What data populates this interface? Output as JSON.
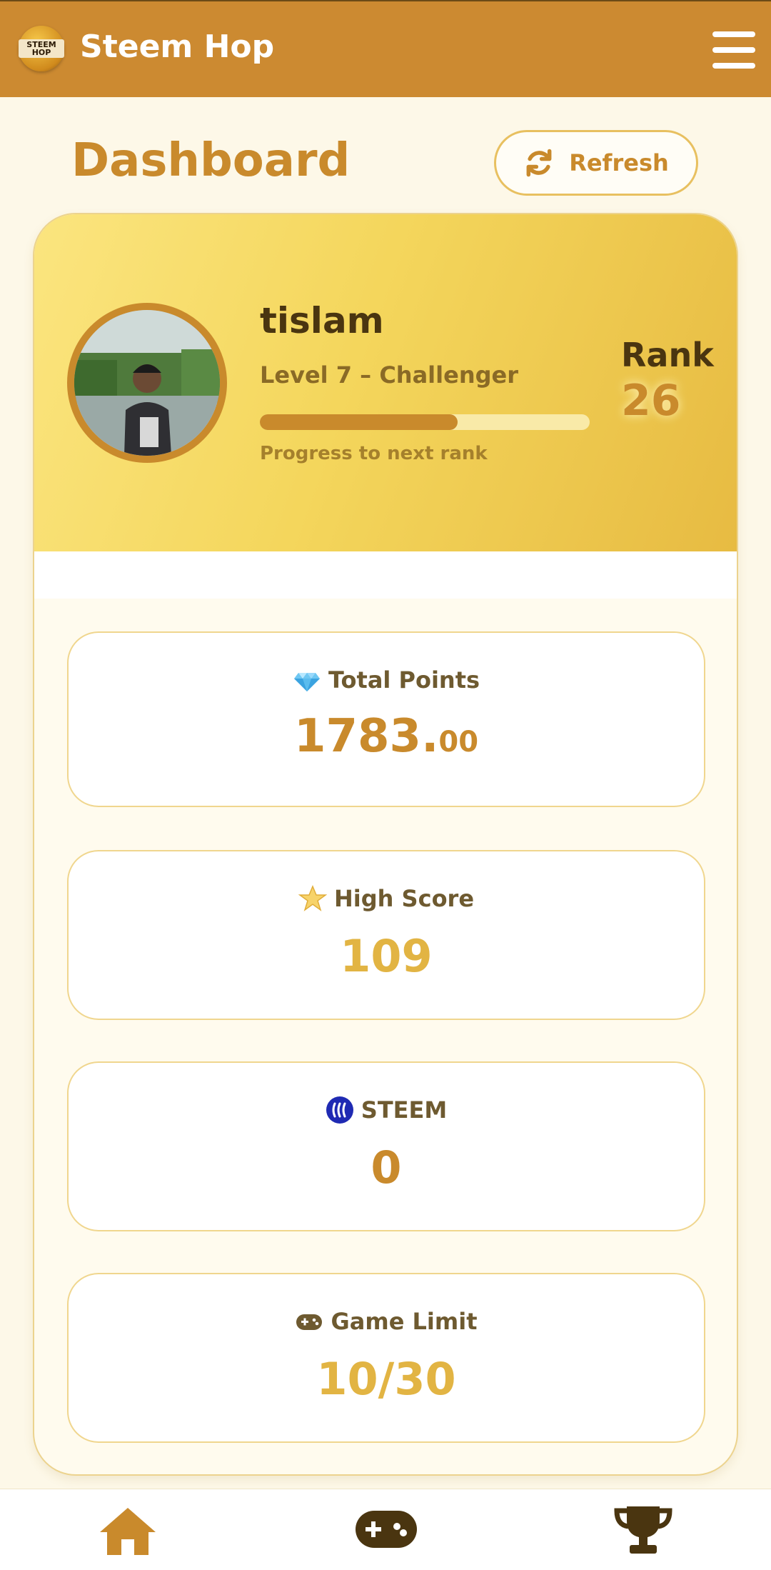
{
  "header": {
    "app_title": "Steem Hop",
    "logo_text": "STEEM HOP"
  },
  "page": {
    "title": "Dashboard",
    "refresh_label": "Refresh"
  },
  "profile": {
    "username": "tislam",
    "level": "Level 7 – Challenger",
    "progress_label": "Progress to next rank",
    "progress_fraction": 0.6,
    "rank_label": "Rank",
    "rank_value": "26"
  },
  "stats": {
    "total_points": {
      "label": "Total Points",
      "value_main": "1783.",
      "value_decimals": "00",
      "icon": "gem-icon"
    },
    "high_score": {
      "label": "High Score",
      "value": "109",
      "icon": "star-icon"
    },
    "steem": {
      "label": "STEEM",
      "value": "0",
      "icon": "steem-icon"
    },
    "game_limit": {
      "label": "Game Limit",
      "value": "10/30",
      "icon": "gamepad-icon"
    }
  },
  "nav": {
    "items": [
      "home-icon",
      "gamepad-icon",
      "trophy-icon"
    ]
  },
  "colors": {
    "brand": "#cc8a31",
    "accent_gold": "#e8bd44",
    "text_dark": "#4a3510",
    "steem_blue": "#1f2ab3"
  }
}
